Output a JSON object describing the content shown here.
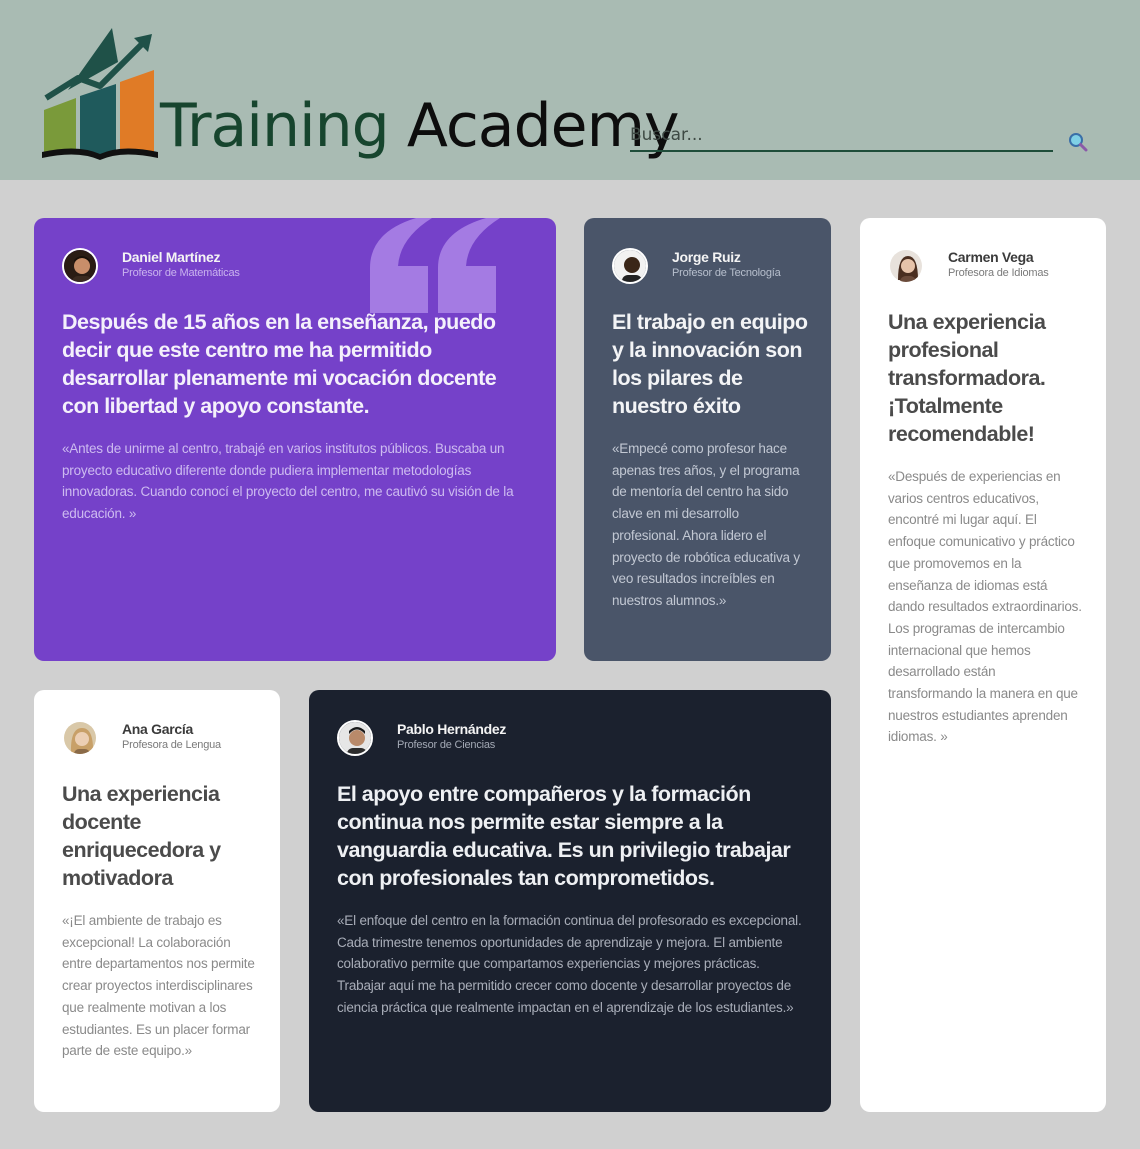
{
  "header": {
    "logo_word1": "Training",
    "logo_word2": "Academy",
    "search_placeholder": "Buscar...",
    "search_icon": "search-icon"
  },
  "colors": {
    "header_bg": "#a9bbb3",
    "page_bg": "#d0d0d0",
    "purple_card": "#7541c9",
    "slate_card": "#4a5569",
    "dark_card": "#1b212e",
    "white_card": "#ffffff"
  },
  "testimonials": [
    {
      "name": "Daniel Martínez",
      "role": "Profesor de Matemáticas",
      "headline": "Después de 15 años en la enseñanza, puedo decir que este centro me ha permitido desarrollar plenamente mi vocación docente con libertad y apoyo constante.",
      "body": "«Antes de unirme al centro, trabajé en varios institutos públicos. Buscaba un proyecto educativo diferente donde pudiera implementar metodologías innovadoras. Cuando conocí el proyecto del centro, me cautivó su visión de la educación. »"
    },
    {
      "name": "Jorge Ruiz",
      "role": "Profesor de Tecnología",
      "headline": "El trabajo en equipo y la innovación son los pilares de nuestro éxito",
      "body": "«Empecé como profesor hace apenas tres años, y el programa de mentoría del centro ha sido clave en mi desarrollo profesional. Ahora lidero el proyecto de robótica educativa y veo resultados increíbles en nuestros alumnos.»"
    },
    {
      "name": "Carmen Vega",
      "role": "Profesora de Idiomas",
      "headline": "Una experiencia profesional transformadora. ¡Totalmente recomendable!",
      "body": "«Después de experiencias en varios centros educativos, encontré mi lugar aquí. El enfoque comunicativo y práctico que promovemos en la enseñanza de idiomas está dando resultados extraordinarios. Los programas de intercambio internacional que hemos desarrollado están transformando la manera en que nuestros estudiantes aprenden idiomas. »"
    },
    {
      "name": "Ana García",
      "role": "Profesora de Lengua",
      "headline": "Una experiencia docente enriquecedora y motivadora",
      "body": "«¡El ambiente de trabajo es excepcional! La colaboración entre departamentos nos permite crear proyectos interdisciplinares que realmente motivan a los estudiantes. Es un placer formar parte de este equipo.»"
    },
    {
      "name": "Pablo Hernández",
      "role": "Profesor de Ciencias",
      "headline": "El apoyo entre compañeros y la formación continua nos permite estar siempre a la vanguardia educativa. Es un privilegio trabajar con profesionales tan comprometidos.",
      "body": "«El enfoque del centro en la formación continua del profesorado es excepcional. Cada trimestre tenemos oportunidades de aprendizaje y mejora. El ambiente colaborativo permite que compartamos experiencias y mejores prácticas. Trabajar aquí me ha permitido crecer como docente y desarrollar proyectos de ciencia práctica que realmente impactan en el aprendizaje de los estudiantes.»"
    }
  ]
}
